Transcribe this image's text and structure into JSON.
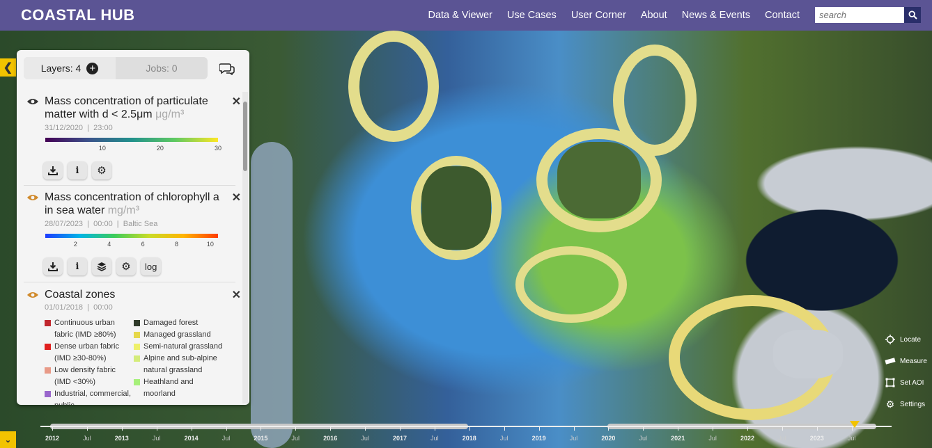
{
  "header": {
    "logo": "COASTAL HUB",
    "nav": [
      "Data & Viewer",
      "Use Cases",
      "User Corner",
      "About",
      "News & Events",
      "Contact"
    ],
    "search_placeholder": "search"
  },
  "panel": {
    "layers_label": "Layers:",
    "layers_count": "4",
    "jobs_label": "Jobs:",
    "jobs_count": "0",
    "layers": [
      {
        "title": "Mass concentration of particulate matter with d < 2.5μm",
        "unit": "μg/m³",
        "date": "31/12/2020",
        "time": "23:00",
        "region": "",
        "ticks": [
          "10",
          "20",
          "30"
        ],
        "colormap": "viridis"
      },
      {
        "title": "Mass concentration of chlorophyll a in sea water",
        "unit": "mg/m³",
        "date": "28/07/2023",
        "time": "00:00",
        "region": "Baltic Sea",
        "ticks": [
          "2",
          "4",
          "6",
          "8",
          "10"
        ],
        "colormap": "jet",
        "log_label": "log"
      },
      {
        "title": "Coastal zones",
        "date": "01/01/2018",
        "time": "00:00",
        "legend_left": [
          {
            "label": "Continuous urban fabric (IMD ≥80%)",
            "color": "#c0272d"
          },
          {
            "label": "Dense urban fabric (IMD ≥30-80%)",
            "color": "#e0201e"
          },
          {
            "label": "Low density fabric (IMD <30%)",
            "color": "#e89a87"
          },
          {
            "label": "Industrial, commercial, public",
            "color": "#9966cc"
          }
        ],
        "legend_right": [
          {
            "label": "Damaged forest",
            "color": "#2f3a2a"
          },
          {
            "label": "Managed grassland",
            "color": "#e6d84a"
          },
          {
            "label": "Semi-natural grassland",
            "color": "#eef06a"
          },
          {
            "label": "Alpine and sub-alpine natural grassland",
            "color": "#d4ec7a"
          },
          {
            "label": "Heathland and moorland",
            "color": "#a6f07a"
          }
        ]
      }
    ]
  },
  "map_tools": [
    "Locate",
    "Measure",
    "Set AOI",
    "Settings"
  ],
  "timeline": {
    "labels": [
      "2012",
      "Jul",
      "2013",
      "Jul",
      "2014",
      "Jul",
      "2015",
      "Jul",
      "2016",
      "Jul",
      "2017",
      "Jul",
      "2018",
      "Jul",
      "2019",
      "Jul",
      "2020",
      "Jul",
      "2021",
      "Jul",
      "2022",
      "Jul",
      "2023",
      "Jul"
    ]
  },
  "colors": {
    "header": "#5b5494",
    "accent": "#f2c300",
    "search_button": "#2a2e6a"
  }
}
